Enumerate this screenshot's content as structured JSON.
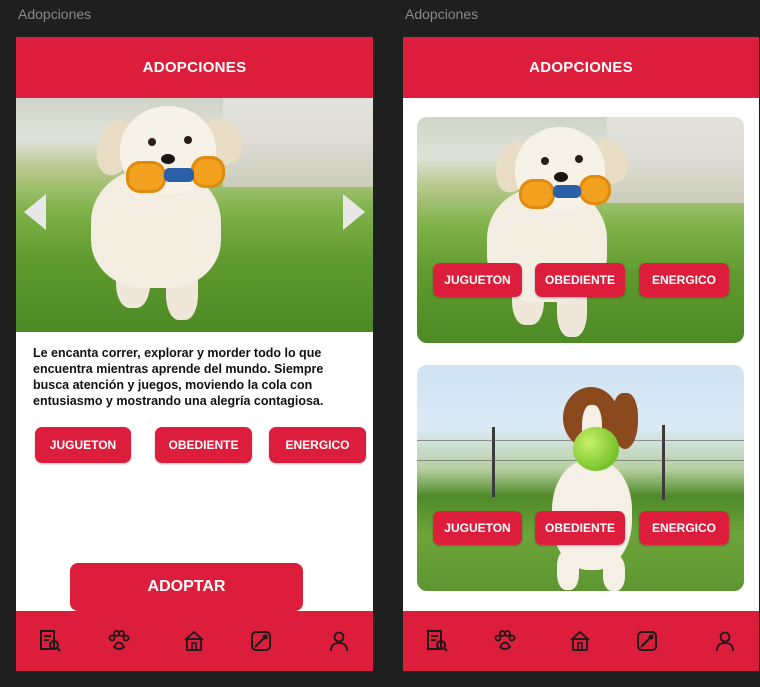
{
  "frames": {
    "left_title": "Adopciones",
    "right_title": "Adopciones"
  },
  "header": {
    "title": "ADOPCIONES"
  },
  "detail": {
    "description": "Le encanta correr, explorar y morder todo lo que encuentra mientras aprende del mundo. Siempre busca atención y juegos, moviendo la cola con entusiasmo y mostrando una alegría contagiosa.",
    "tags": [
      "JUGUETON",
      "OBEDIENTE",
      "ENERGICO"
    ],
    "adopt_label": "ADOPTAR"
  },
  "list": {
    "cards": [
      {
        "tags": [
          "JUGUETON",
          "OBEDIENTE",
          "ENERGICO"
        ]
      },
      {
        "tags": [
          "JUGUETON",
          "OBEDIENTE",
          "ENERGICO"
        ]
      }
    ]
  },
  "nav": {
    "items": [
      "document-search-icon",
      "paw-icon",
      "home-icon",
      "map-icon",
      "user-icon"
    ]
  },
  "colors": {
    "accent": "#dc1e3c",
    "background": "#1f1f1f"
  }
}
